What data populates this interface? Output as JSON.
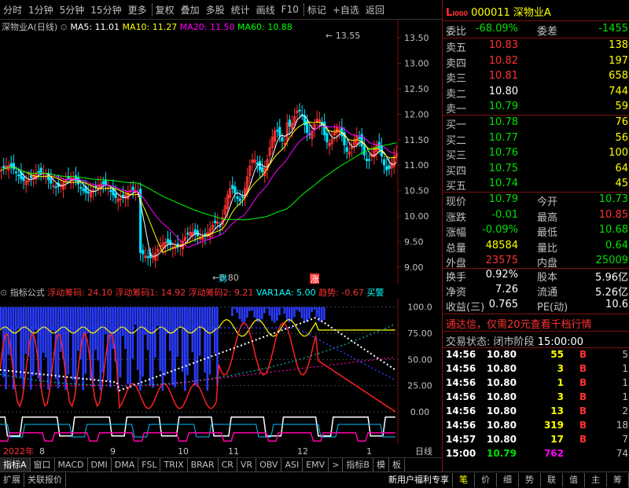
{
  "toolbar": {
    "items": [
      "分时",
      "1分钟",
      "5分钟",
      "15分钟",
      "更多",
      "复权",
      "叠加",
      "多股",
      "统计",
      "画线",
      "F10",
      "标记",
      "+自选",
      "返回"
    ]
  },
  "chart_legend": {
    "stock": "深物业A(日线)",
    "ma5": "MA5: 11.01",
    "ma10": "MA10: 11.27",
    "ma20": "MA20: 11.50",
    "ma60": "MA60: 10.88"
  },
  "chart_data": {
    "type": "candlestick",
    "y_ticks": [
      "13.50",
      "13.00",
      "12.50",
      "12.00",
      "11.50",
      "11.00",
      "10.50",
      "10.00",
      "9.50",
      "9.00"
    ],
    "ylim": [
      8.75,
      13.75
    ],
    "high_label": "13.55",
    "low_label": "8.80",
    "markers": [
      "财",
      "涨"
    ],
    "indicator_ticks": [
      "100.0",
      "75.00",
      "50.00",
      "25.00",
      "0.00"
    ],
    "indicator_ylim": [
      -30,
      105
    ],
    "date_ticks": [
      "2022年",
      "8",
      "9",
      "10",
      "11",
      "12",
      "1",
      "日线"
    ]
  },
  "indicator_bar": {
    "name": "指标公式",
    "items": [
      {
        "text": "浮动筹码: 24.10",
        "color": "#ff3232"
      },
      {
        "text": "浮动筹码1: 14.92",
        "color": "#ff3232"
      },
      {
        "text": "浮动筹码2: 9.21",
        "color": "#ff3232"
      },
      {
        "text": "VAR1AA: 5.00",
        "color": "#00ffff"
      },
      {
        "text": "趋势: -0.67",
        "color": "#ff3232"
      },
      {
        "text": "买警",
        "color": "#00ffff"
      }
    ]
  },
  "tabs": [
    "指标A",
    "窗口",
    "MACD",
    "DMI",
    "DMA",
    "FSL",
    "TRIX",
    "BRAR",
    "CR",
    "VR",
    "OBV",
    "ASI",
    "EMV",
    ">",
    "指标B",
    "模",
    "板"
  ],
  "status_bar": {
    "left": [
      "扩展",
      "关联报价"
    ],
    "promo": "新用户福利专享",
    "right": [
      "笔",
      "价",
      "细",
      "势",
      "联",
      "值",
      "主",
      "筹"
    ]
  },
  "quote": {
    "code": "000011",
    "name": "深物业A",
    "webi_label": "委比",
    "webi": "-68.09%",
    "weicha_label": "委差",
    "weicha": "-1455",
    "asks": [
      {
        "label": "卖五",
        "price": "10.83",
        "vol": "138"
      },
      {
        "label": "卖四",
        "price": "10.82",
        "vol": "197"
      },
      {
        "label": "卖三",
        "price": "10.81",
        "vol": "658"
      },
      {
        "label": "卖二",
        "price": "10.80",
        "vol": "744"
      },
      {
        "label": "卖一",
        "price": "10.79",
        "vol": "59"
      }
    ],
    "bids": [
      {
        "label": "买一",
        "price": "10.78",
        "vol": "76"
      },
      {
        "label": "买二",
        "price": "10.77",
        "vol": "56"
      },
      {
        "label": "买三",
        "price": "10.76",
        "vol": "100"
      },
      {
        "label": "买四",
        "price": "10.75",
        "vol": "64"
      },
      {
        "label": "买五",
        "price": "10.74",
        "vol": "45"
      }
    ],
    "stats": [
      {
        "l1": "现价",
        "v1": "10.79",
        "l2": "今开",
        "v2": "10.73"
      },
      {
        "l1": "涨跌",
        "v1": "-0.01",
        "l2": "最高",
        "v2": "10.85"
      },
      {
        "l1": "涨幅",
        "v1": "-0.09%",
        "l2": "最低",
        "v2": "10.68"
      },
      {
        "l1": "总量",
        "v1": "48584",
        "l2": "量比",
        "v2": "0.64"
      },
      {
        "l1": "外盘",
        "v1": "23575",
        "l2": "内盘",
        "v2": "25009"
      }
    ],
    "stats2": [
      {
        "l1": "换手",
        "v1": "0.92%",
        "l2": "股本",
        "v2": "5.96亿"
      },
      {
        "l1": "净资",
        "v1": "7.26",
        "l2": "流通",
        "v2": "5.26亿"
      },
      {
        "l1": "收益(三)",
        "v1": "0.765",
        "l2": "PE(动)",
        "v2": "10.6"
      }
    ],
    "ad": "通达信，仅需20元查看千档行情",
    "trade_status_label": "交易状态:",
    "trade_status": "闭市阶段",
    "trade_time": "15:00:00",
    "trades": [
      {
        "t": "14:56",
        "p": "10.80",
        "v": "55",
        "d": "B",
        "n": "5"
      },
      {
        "t": "14:56",
        "p": "10.80",
        "v": "3",
        "d": "B",
        "n": "1"
      },
      {
        "t": "14:56",
        "p": "10.80",
        "v": "1",
        "d": "B",
        "n": "1"
      },
      {
        "t": "14:56",
        "p": "10.80",
        "v": "3",
        "d": "B",
        "n": "1"
      },
      {
        "t": "14:56",
        "p": "10.80",
        "v": "13",
        "d": "B",
        "n": "2"
      },
      {
        "t": "14:56",
        "p": "10.80",
        "v": "319",
        "d": "B",
        "n": "18"
      },
      {
        "t": "14:57",
        "p": "10.80",
        "v": "17",
        "d": "B",
        "n": "7"
      },
      {
        "t": "15:00",
        "p": "10.79",
        "v": "762",
        "d": "",
        "n": "74"
      }
    ]
  },
  "colors": {
    "up": "#ff3232",
    "down": "#00e0ff",
    "ma5": "#ffffff",
    "ma10": "#ffff00",
    "ma20": "#ff00ff",
    "ma60": "#00ff00",
    "border": "#7a1111"
  }
}
